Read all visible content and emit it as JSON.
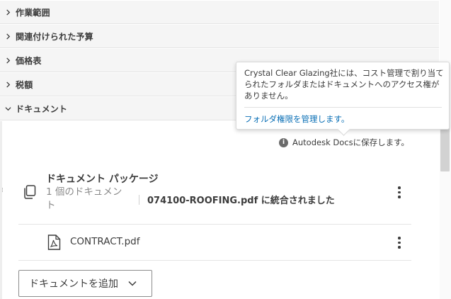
{
  "accordion": [
    {
      "label": "作業範囲",
      "expanded": false
    },
    {
      "label": "関連付けられた予算",
      "expanded": false
    },
    {
      "label": "価格表",
      "expanded": false
    },
    {
      "label": "税額",
      "expanded": false
    },
    {
      "label": "ドキュメント",
      "expanded": true
    }
  ],
  "tooltip": {
    "message": "Crystal Clear Glazing社には、コスト管理で割り当てられたフォルダまたはドキュメントへのアクセス権がありません。",
    "link": "フォルダ権限を管理します。"
  },
  "save_note": {
    "icon": "info-icon",
    "text": "Autodesk Docsに保存します。"
  },
  "package": {
    "title": "ドキュメント パッケージ",
    "count": "1 個のドキュメント",
    "merged": "074100-ROOFING.pdf に統合されました"
  },
  "file": {
    "name": "CONTRACT.pdf",
    "icon": "pdf-icon"
  },
  "add_button": {
    "label": "ドキュメントを追加"
  },
  "colors": {
    "link": "#0a6fb5",
    "header_bg": "#f5f5f5",
    "text": "#3c3c3c",
    "muted": "#8a8a8a"
  }
}
